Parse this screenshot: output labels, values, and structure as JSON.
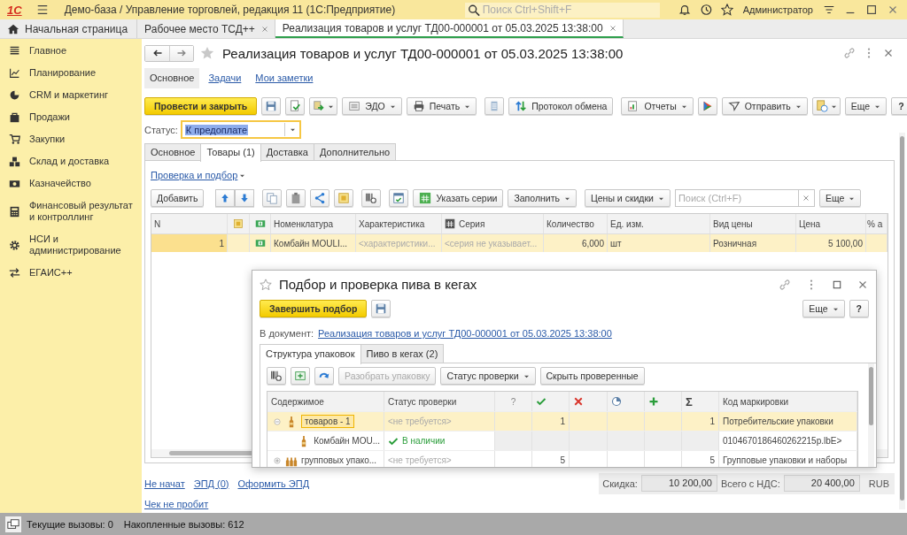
{
  "app_bar": {
    "logo": "1С",
    "title": "Демо-база / Управление торговлей, редакция 11  (1С:Предприятие)",
    "search": {
      "placeholder": "Поиск Ctrl+Shift+F"
    },
    "user": "Администратор"
  },
  "open_tabs": [
    {
      "label": "Начальная страница",
      "kind": "home",
      "selected": false
    },
    {
      "label": "Рабочее место ТСД++",
      "kind": "tab",
      "selected": false
    },
    {
      "label": "Реализация товаров и услуг ТД00-000001 от 05.03.2025 13:38:00",
      "kind": "tab",
      "selected": true
    }
  ],
  "sidebar": {
    "items": [
      {
        "label": "Главное",
        "kind": "list"
      },
      {
        "label": "Планирование",
        "kind": "plan"
      },
      {
        "label": "CRM и маркетинг",
        "kind": "crm"
      },
      {
        "label": "Продажи",
        "kind": "bag"
      },
      {
        "label": "Закупки",
        "kind": "cart"
      },
      {
        "label": "Склад и доставка",
        "kind": "stock"
      },
      {
        "label": "Казначейство",
        "kind": "money"
      },
      {
        "label": "Финансовый результат и контроллинг",
        "kind": "finance"
      },
      {
        "label": "НСИ и администрирование",
        "kind": "admin"
      },
      {
        "label": "ЕГАИС++",
        "kind": "egais"
      }
    ]
  },
  "document": {
    "title": "Реализация товаров и услуг ТД00-000001 от 05.03.2025 13:38:00",
    "sections": [
      {
        "label": "Основное",
        "selected": true
      },
      {
        "label": "Задачи",
        "selected": false
      },
      {
        "label": "Мои заметки",
        "selected": false
      }
    ],
    "toolbar": {
      "post": "Провести и закрыть",
      "edo": "ЭДО",
      "print": "Печать",
      "exchange_log": "Протокол обмена",
      "reports": "Отчеты",
      "send": "Отправить",
      "more": "Еще",
      "help": "?"
    },
    "status": {
      "label": "Статус:",
      "value": "К предоплате"
    },
    "tabs": [
      {
        "label": "Основное",
        "selected": false
      },
      {
        "label": "Товары (1)",
        "selected": true
      },
      {
        "label": "Доставка",
        "selected": false
      },
      {
        "label": "Дополнительно",
        "selected": false
      }
    ],
    "goods": {
      "check_link": "Проверка и подбор",
      "toolbar": {
        "add": "Добавить",
        "series": "Указать серии",
        "fill": "Заполнить",
        "prices": "Цены и скидки",
        "search_placeholder": "Поиск (Ctrl+F)",
        "more": "Еще"
      },
      "table": {
        "columns": [
          "N",
          "Номенклатура",
          "Характеристика",
          "Серия",
          "Количество",
          "Ед. изм.",
          "Вид цены",
          "Цена",
          "% а"
        ],
        "rows": [
          {
            "n": "1",
            "name": "Комбайн MOULI...",
            "characteristic": "<характеристики...",
            "series": "<серия не указывает...",
            "quantity": "6,000",
            "unit": "шт",
            "price_type": "Розничная",
            "price": "5 100,00",
            "selected": true
          }
        ]
      }
    },
    "footer": {
      "links": [
        "Не начат",
        "ЭПД (0)",
        "Оформить ЭПД"
      ],
      "discount_label": "Скидка:",
      "discount": "10 200,00",
      "total_label": "Всего с НДС:",
      "total": "20 400,00",
      "currency": "RUB",
      "receipt": "Чек не пробит"
    }
  },
  "popup": {
    "title": "Подбор и проверка пива в кегах",
    "finish": "Завершить подбор",
    "more": "Еще",
    "help": "?",
    "doc_label": "В документ:",
    "doc_link": "Реализация товаров и услуг ТД00-000001 от 05.03.2025 13:38:00",
    "tabs": [
      {
        "label": "Структура упаковок",
        "selected": true
      },
      {
        "label": "Пиво в кегах (2)",
        "selected": false
      }
    ],
    "toolbar": {
      "unpack": {
        "label": "Разобрать упаковку",
        "disabled": true
      },
      "status": "Статус проверки",
      "hide": "Скрыть проверенные"
    },
    "tree": {
      "columns": [
        "Содержимое",
        "Статус проверки",
        "?",
        "Σ",
        "Код маркировки"
      ],
      "rows": [
        {
          "kind": "pack",
          "content": "товаров - 1",
          "status": "<не требуется>",
          "in_stock": false,
          "ok": "1",
          "sigma": "1",
          "code": "Потребительские упаковки",
          "expanded": true,
          "selected": true,
          "children": [
            {
              "kind": "pack",
              "content": "Комбайн MOU...",
              "status": "В наличии",
              "in_stock": true,
              "code": "0104670186460262215p.lbE>",
              "selected": false
            }
          ]
        },
        {
          "kind": "group",
          "content": "групповых упако...",
          "status": "<не требуется>",
          "in_stock": false,
          "ok": "5",
          "sigma": "5",
          "code": "Групповые упаковки и наборы",
          "expanded": false,
          "selected": false
        }
      ]
    }
  },
  "status_bar": {
    "current": "Текущие вызовы: 0",
    "accumulated": "Накопленные вызовы: 612"
  }
}
